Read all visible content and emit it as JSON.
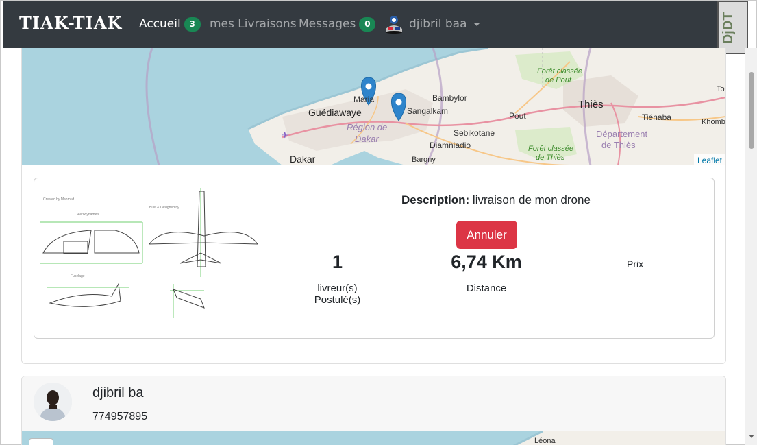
{
  "navbar": {
    "brand": "TIAK-TIAK",
    "items": [
      {
        "label": "Accueil",
        "badge": "3",
        "active": true
      },
      {
        "label": "mes Livraisons"
      },
      {
        "label": "Messages",
        "badge": "0"
      }
    ],
    "user": {
      "name": "djibril baa",
      "avatar_icon": "user-avatar-icon"
    },
    "badge_color": "#198754",
    "background": "#343a40"
  },
  "map1": {
    "labels": {
      "mariste": "Maria",
      "bambylor": "Bambylor",
      "guediawaye": "Guédiawaye",
      "sangalkam": "Sangalkam",
      "thies": "Thiès",
      "pout": "Pout",
      "tienaba": "Tiénaba",
      "region_dakar_1": "Région de",
      "region_dakar_2": "Dakar",
      "sebikotane": "Sebikotane",
      "diamniadio": "Diamniadio",
      "dept_thies_1": "Département",
      "dept_thies_2": "de Thiès",
      "dakar": "Dakar",
      "bargny": "Bargny",
      "foret_pout_1": "Forêt classée",
      "foret_pout_2": "de Pout",
      "foret_thies_1": "Forêt classée",
      "foret_thies_2": "de Thiès",
      "khombole": "Khomb",
      "to": "To"
    },
    "attribution": "Leaflet"
  },
  "delivery": {
    "description_label": "Description:",
    "description_value": "livraison de mon drone",
    "cancel_label": "Annuler",
    "applicants_value": "1",
    "applicants_label": "livreur(s) Postulé(s)",
    "distance_value": "6,74 Km",
    "distance_label": "Distance",
    "price_label": "Prix",
    "cancel_color": "#dc3545"
  },
  "courier": {
    "name": "djibril ba",
    "phone": "774957895"
  },
  "map2": {
    "label": "Léona"
  }
}
